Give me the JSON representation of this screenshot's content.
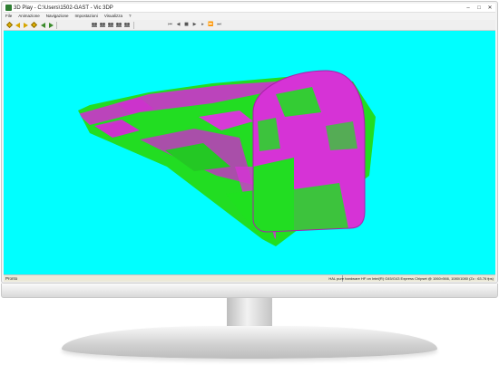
{
  "window": {
    "title": "3D Play - C:\\Users\\1502-GAST - Vic 3DP",
    "buttons": {
      "minimize": "–",
      "maximize": "□",
      "close": "✕"
    }
  },
  "menu": {
    "items": [
      "File",
      "Animazione",
      "Navigazione",
      "Impostazioni",
      "Visualizza",
      "?"
    ]
  },
  "toolbar": {
    "groups": [
      [
        "diamond-left-icon",
        "arrow-left-icon",
        "arrow-right-icon",
        "diamond-right-icon",
        "prev-green-icon",
        "next-green-icon"
      ],
      [
        "people-icon-1",
        "people-icon-2",
        "people-icon-3",
        "people-icon-4",
        "people-icon-5"
      ],
      [
        "rewind-start-icon",
        "step-back-icon",
        "stop-icon",
        "play-icon",
        "step-forward-icon",
        "fast-forward-icon",
        "skip-end-icon"
      ]
    ]
  },
  "scene": {
    "background_color": "#00ffff",
    "tunnel_color_magenta": "#d633d6",
    "tunnel_color_green": "#22dd22"
  },
  "status": {
    "left": "Pronto",
    "right": "HAL pure hardware HF on Intel(R) G45/G43 Express Chipset @ 1060×566, 1080/1080 (Zc : 63.76 fps)"
  }
}
